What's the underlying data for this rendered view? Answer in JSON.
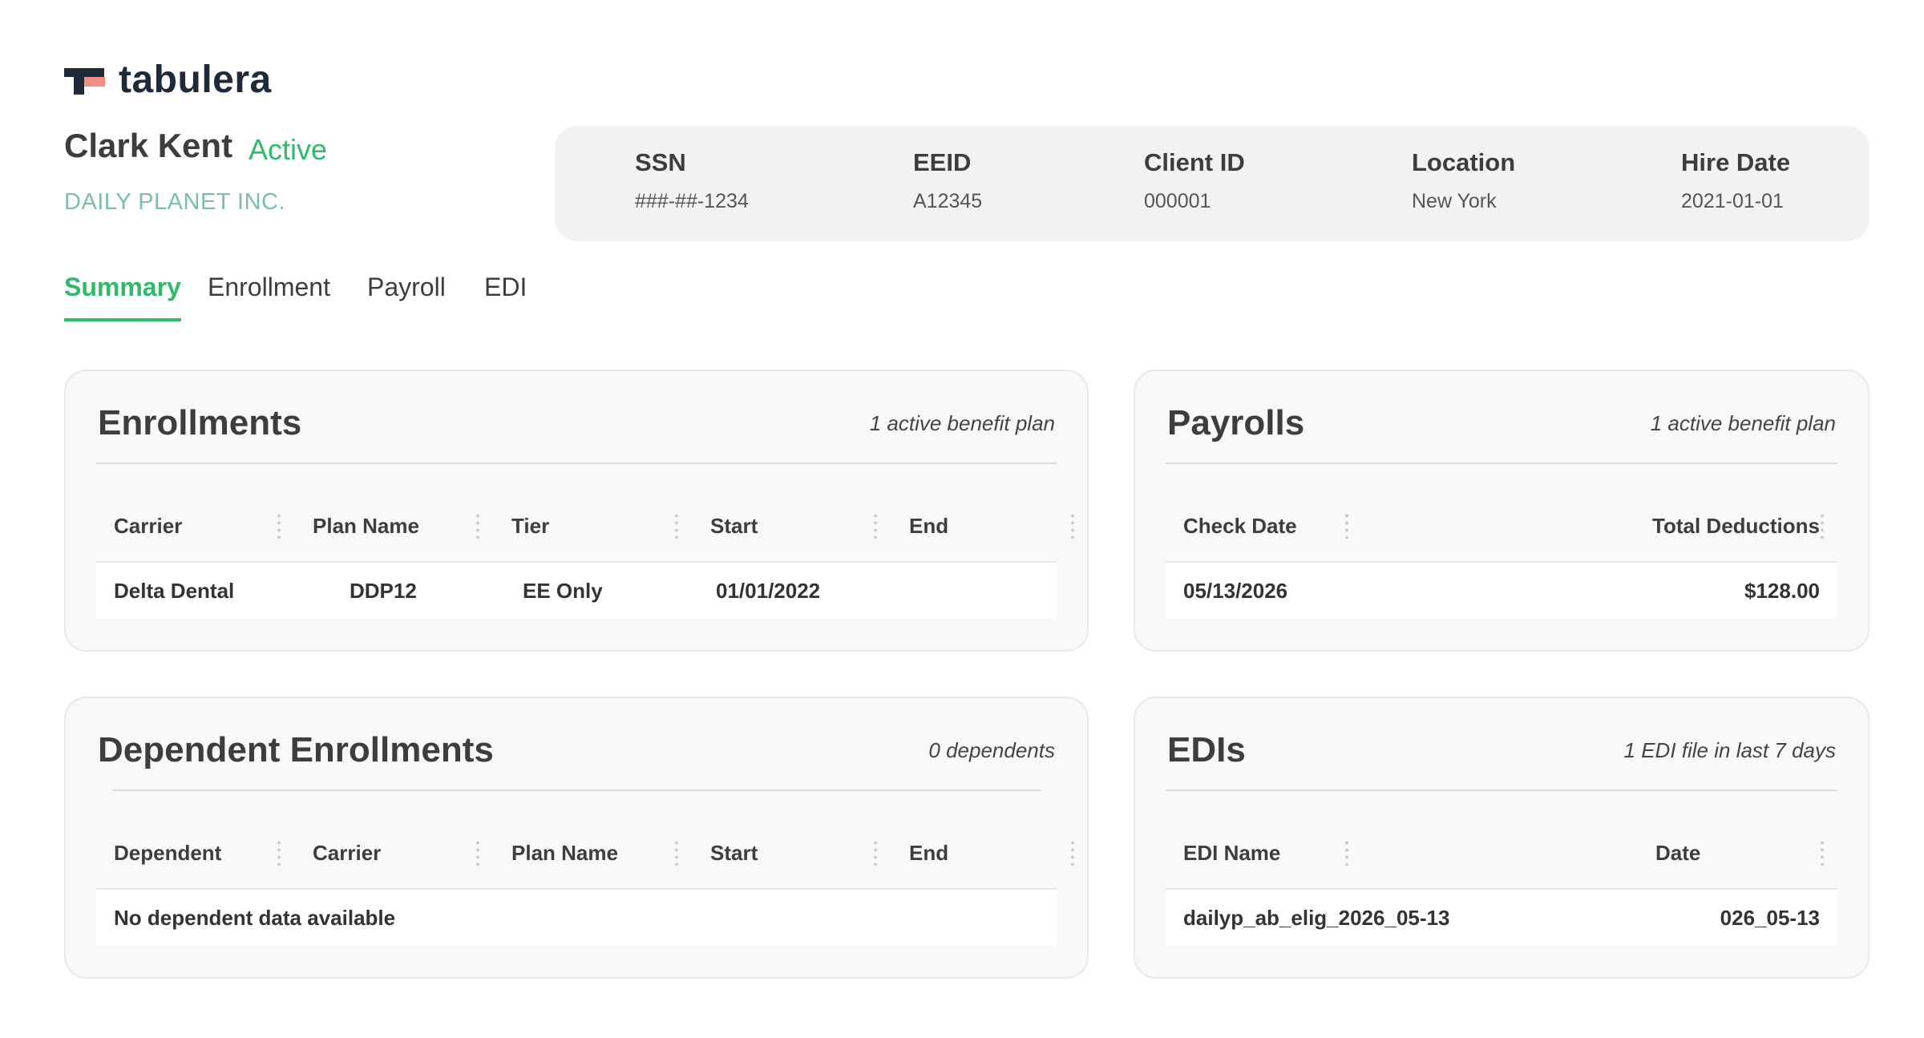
{
  "brand": {
    "name": "tabulera"
  },
  "employee": {
    "name": "Clark Kent",
    "status": "Active",
    "company": "DAILY PLANET INC."
  },
  "info": {
    "ssn_label": "SSN",
    "ssn": "###-##-1234",
    "eeid_label": "EEID",
    "eeid": "A12345",
    "client_id_label": "Client ID",
    "client_id": "000001",
    "location_label": "Location",
    "location": "New York",
    "hire_date_label": "Hire Date",
    "hire_date": "2021-01-01"
  },
  "tabs": [
    {
      "label": "Summary",
      "active": true
    },
    {
      "label": "Enrollment",
      "active": false
    },
    {
      "label": "Payroll",
      "active": false
    },
    {
      "label": "EDI",
      "active": false
    }
  ],
  "enrollments": {
    "title": "Enrollments",
    "meta": "1 active benefit plan",
    "columns": [
      "Carrier",
      "Plan Name",
      "Tier",
      "Start",
      "End"
    ],
    "rows": [
      [
        "Delta Dental",
        "DDP12",
        "EE Only",
        "01/01/2022",
        ""
      ]
    ]
  },
  "payrolls": {
    "title": "Payrolls",
    "meta": "1 active benefit plan",
    "columns": [
      "Check Date",
      "Total Deductions"
    ],
    "rows": [
      [
        "05/13/2026",
        "$128.00"
      ]
    ]
  },
  "dependents": {
    "title": "Dependent Enrollments",
    "meta": "0 dependents",
    "columns": [
      "Dependent",
      "Carrier",
      "Plan Name",
      "Start",
      "End"
    ],
    "empty_message": "No dependent data available"
  },
  "edis": {
    "title": "EDIs",
    "meta": "1 EDI file in last 7 days",
    "columns": [
      "EDI Name",
      "Date"
    ],
    "rows": [
      [
        "dailyp_ab_elig_2026_05-13",
        "026_05-13"
      ]
    ]
  },
  "colors": {
    "accent": "#2fb96a",
    "company": "#7bbfa4",
    "brand_dark": "#1e2a3a",
    "brand_pink": "#ef8f86"
  }
}
